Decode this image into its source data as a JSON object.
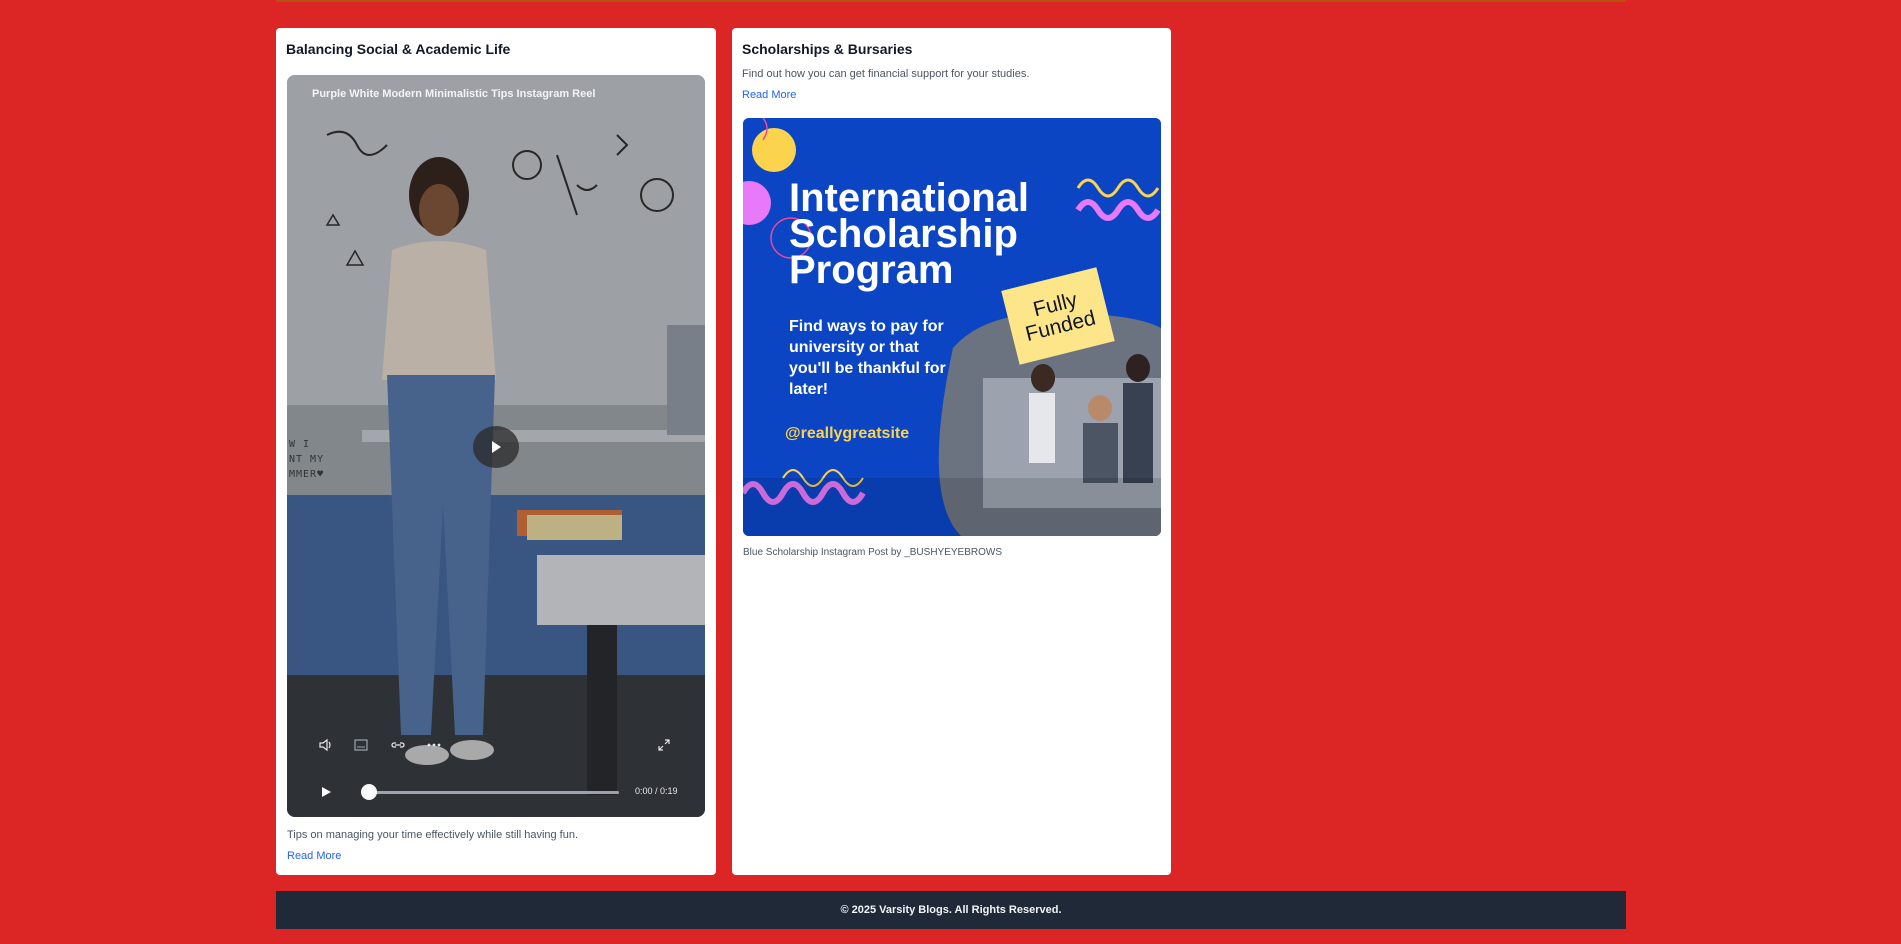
{
  "cards": {
    "social": {
      "title": "Balancing Social & Academic Life",
      "video_title": "Purple White Modern Minimalistic Tips Instagram Reel",
      "time": "0:00 / 0:19",
      "progress": 0,
      "description": "Tips on managing your time effectively while still having fun.",
      "read_more": "Read More",
      "whiteboard_note": [
        "W I",
        "NT MY",
        "MMER♥"
      ]
    },
    "scholarships": {
      "title": "Scholarships & Bursaries",
      "description": "Find out how you can get financial support for your studies.",
      "read_more": "Read More",
      "poster": {
        "heading": [
          "International",
          "Scholarship",
          "Program"
        ],
        "subtext": "Find ways to pay for university or that you'll be thankful for later!",
        "handle": "@reallygreatsite",
        "badge": "Fully Funded"
      },
      "caption": "Blue Scholarship Instagram Post by _BUSHYEYEBROWS"
    }
  },
  "footer": {
    "text": "© 2025 Varsity Blogs. All Rights Reserved."
  },
  "colors": {
    "page": "#dc2626",
    "footer": "#1f2937",
    "link": "#2563eb",
    "poster_blue": "#0b45c4",
    "badge": "#fde68a"
  },
  "icons": [
    "volume-icon",
    "captions-icon",
    "link-icon",
    "more-icon",
    "fullscreen-icon",
    "play-icon"
  ]
}
